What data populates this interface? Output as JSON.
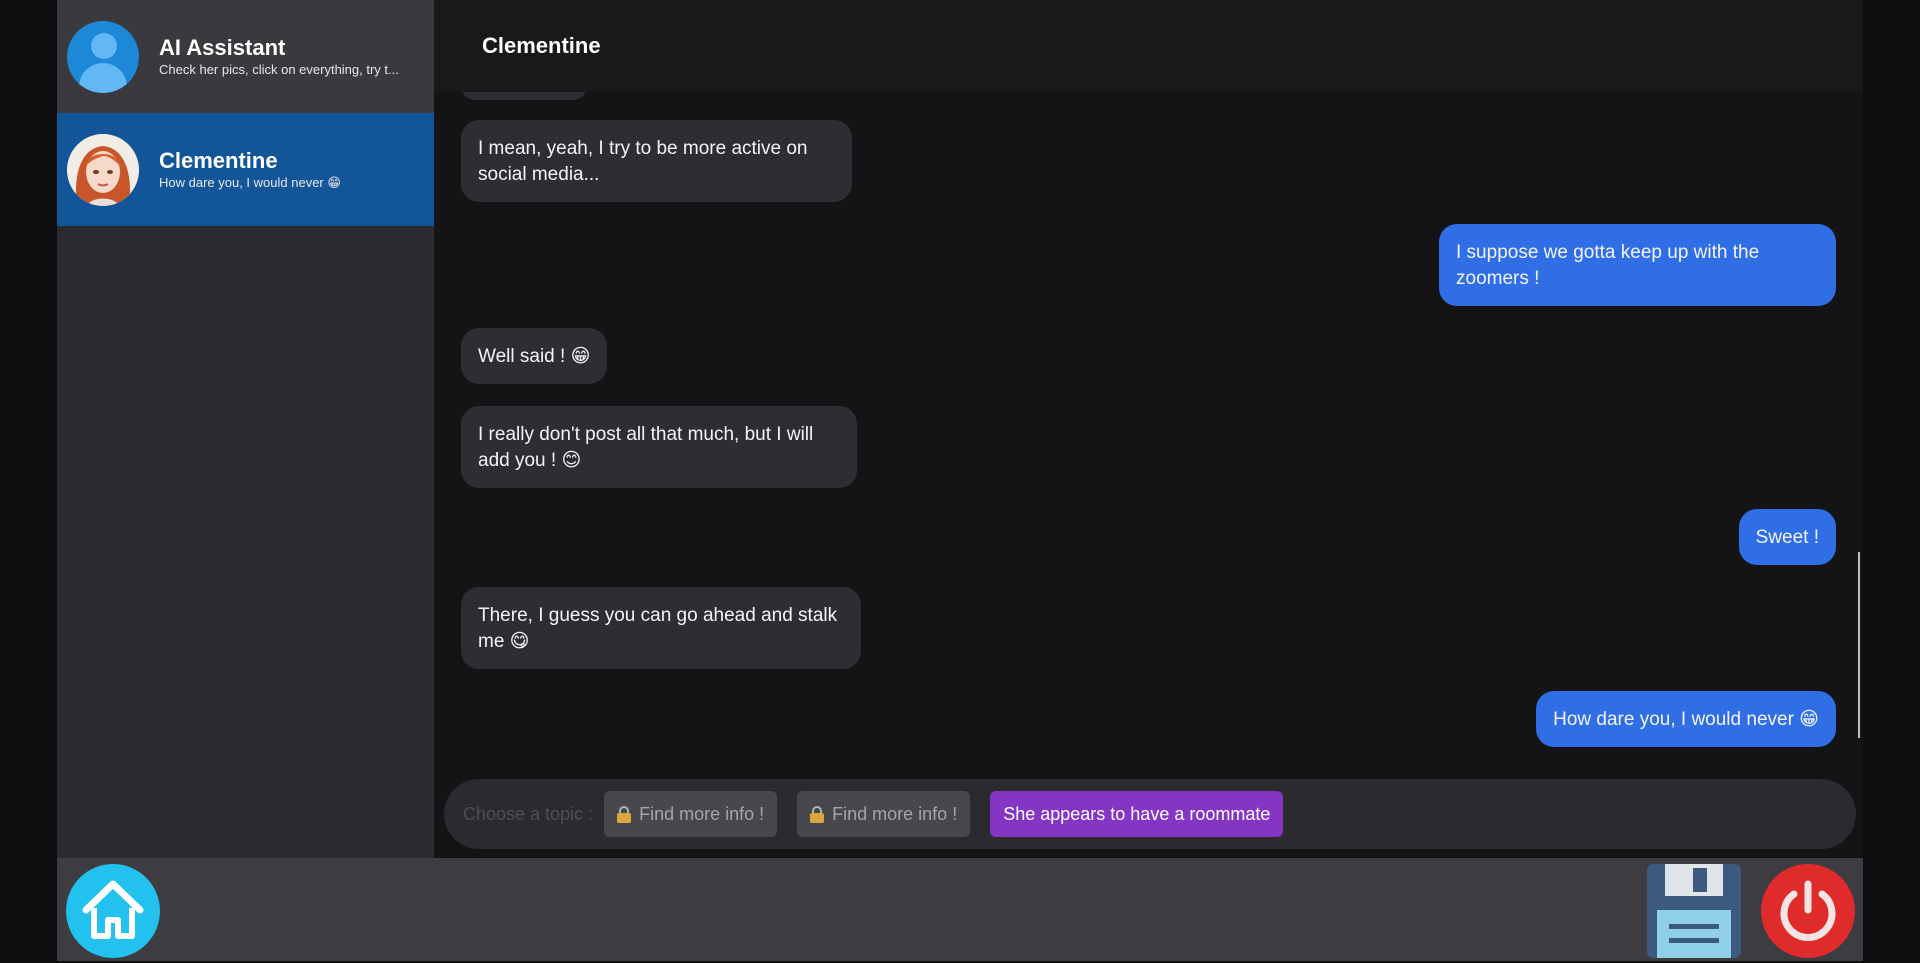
{
  "sidebar": {
    "contacts": [
      {
        "name": "AI Assistant",
        "preview": "Check her pics, click on everything, try t..."
      },
      {
        "name": "Clementine",
        "preview": "How dare you, I would never 😁"
      }
    ]
  },
  "chat": {
    "title": "Clementine",
    "messages": [
      {
        "from": "them",
        "text": "I mean, yeah, I try to be more active on social media..."
      },
      {
        "from": "me",
        "text": "I suppose we gotta keep up with the zoomers !"
      },
      {
        "from": "them",
        "text": "Well said ! 😁"
      },
      {
        "from": "them",
        "text": "I really don't post all that much, but I will add you ! 😊"
      },
      {
        "from": "me",
        "text": "Sweet !"
      },
      {
        "from": "them",
        "text": "There, I guess you can go ahead and stalk me 😋"
      },
      {
        "from": "me",
        "text": "How dare you, I would never 😁"
      }
    ]
  },
  "topics": {
    "label": "Choose a topic :",
    "options": [
      {
        "label": "Find more info !",
        "locked": true
      },
      {
        "label": "Find more info !",
        "locked": true
      },
      {
        "label": "She appears to have a roommate",
        "locked": false
      }
    ]
  },
  "icons": {
    "home": "home-icon",
    "save": "floppy-disk-icon",
    "power": "power-icon",
    "lock": "lock-icon"
  },
  "colors": {
    "accent_active_contact": "#125699",
    "outgoing_bubble": "#2f6ee5",
    "incoming_bubble": "#2e2d31",
    "topic_special": "#8435c4",
    "home_button": "#22c1ee",
    "power_button": "#e02b2b"
  }
}
